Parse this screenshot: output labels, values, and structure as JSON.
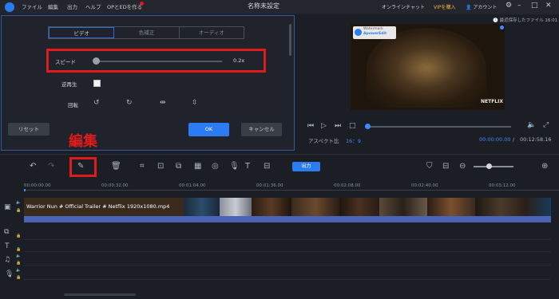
{
  "titlebar": {
    "menu": [
      "ファイル",
      "編集",
      "出力",
      "ヘルプ",
      "OPとEDを作る"
    ],
    "title": "名称未設定",
    "chat": "オンラインチャット",
    "vip": "VIPを購入",
    "account": "アカウント"
  },
  "saved_note": "最近保存したファイル 16:01",
  "tabs": [
    "ビデオ",
    "色補正",
    "オーディオ"
  ],
  "speed": {
    "label": "スピード",
    "value": "0.2x",
    "position": 0.0
  },
  "reverse": {
    "label": "逆再生",
    "checked": false
  },
  "rotate": {
    "label": "回転"
  },
  "buttons": {
    "reset": "リセット",
    "ok": "OK",
    "cancel": "キャンセル"
  },
  "annotation": "編集",
  "preview": {
    "watermark_top": "Watermark",
    "watermark_brand": "ApowerEdit",
    "brand": "NETFLIX",
    "aspect_label": "アスペクト比",
    "aspect_value": "16：9",
    "time_current": "00:00:00.00",
    "time_total": "00:12:58.16"
  },
  "toolbar": {
    "export": "出力"
  },
  "ruler": [
    "00:00:00.00",
    "00:00:32.00",
    "00:01:04.00",
    "00:01:36.00",
    "00:02:08.00",
    "00:02:40.00",
    "00:03:12.00"
  ],
  "clip": {
    "name": "Warrior Nun # Official Trailer # Netflix 1920x1080.mp4"
  },
  "colors": {
    "accent": "#2b7cf3",
    "annotation_red": "#e01b1b",
    "vip": "#f3b43b"
  }
}
